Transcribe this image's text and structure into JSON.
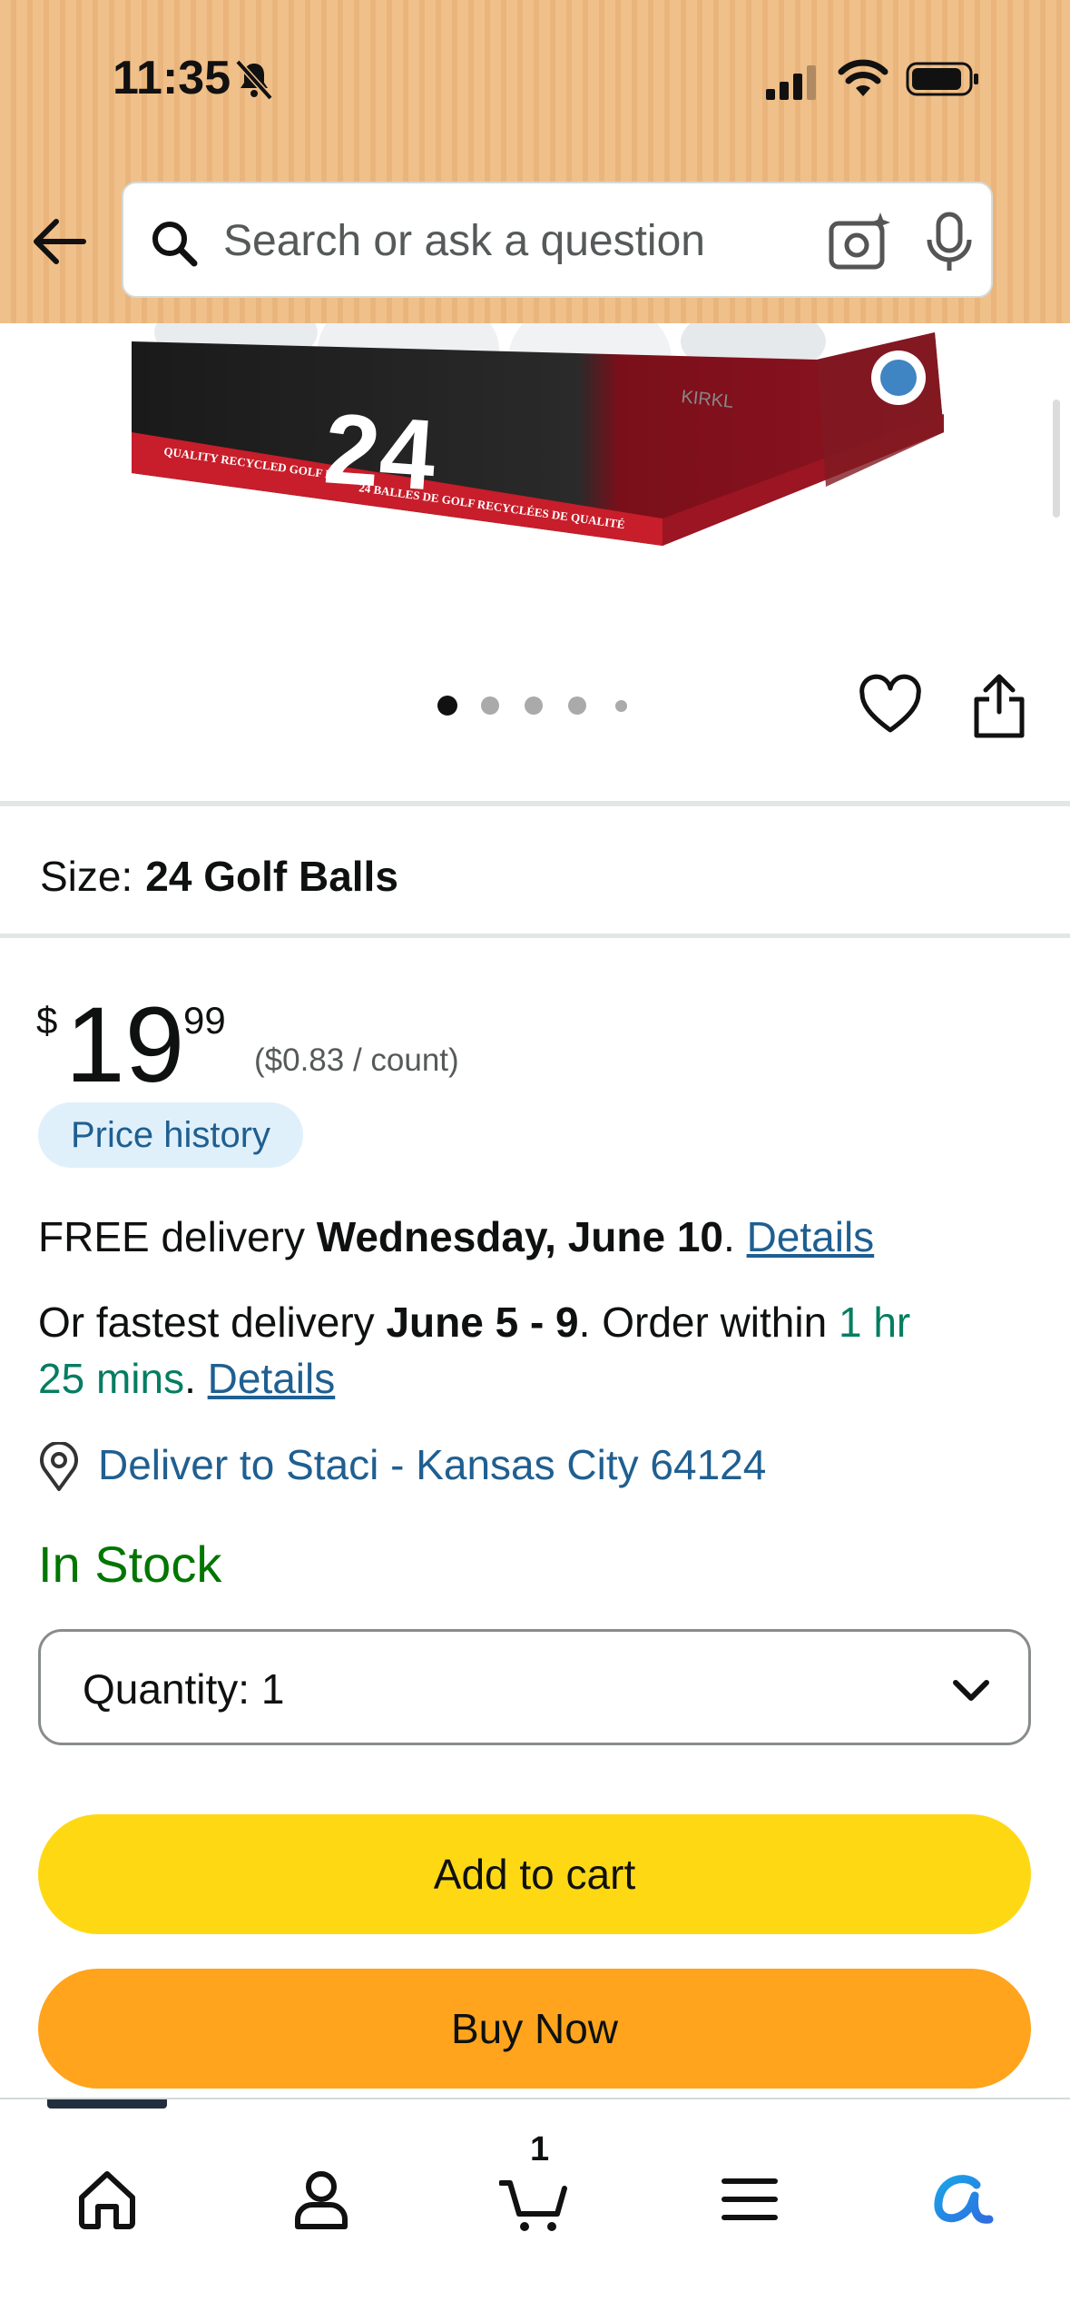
{
  "status_bar": {
    "time": "11:35"
  },
  "search": {
    "placeholder": "Search or ask a question"
  },
  "product": {
    "box_label_number": "24",
    "box_text_en": "QUALITY RECYCLED GOLF BALLS",
    "box_text_fr": "24 BALLES DE GOLF RECYCLÉES DE QUALITÉ",
    "box_brand": "KIRKL",
    "carousel_dots": 5,
    "carousel_active_index": 0
  },
  "size": {
    "label": "Size:",
    "value": "24 Golf Balls"
  },
  "price": {
    "currency": "$",
    "whole": "19",
    "fraction": "99",
    "per_unit": "($0.83 / count)",
    "history_label": "Price history"
  },
  "delivery": {
    "free_prefix": "FREE delivery ",
    "free_date": "Wednesday, June 10",
    "free_suffix": ". ",
    "details_link": "Details",
    "fast_prefix": "Or fastest delivery ",
    "fast_date": "June 5 - 9",
    "fast_mid": ". Order within ",
    "fast_time_part1": "1 hr",
    "fast_time_part2": "25 mins",
    "fast_suffix": ". ",
    "details_link_2": "Details",
    "deliver_to": "Deliver to Staci - Kansas City 64124"
  },
  "stock": {
    "status": "In Stock"
  },
  "quantity": {
    "label": "Quantity:",
    "value": "1"
  },
  "buttons": {
    "add_to_cart": "Add to cart",
    "buy_now": "Buy Now"
  },
  "bottom_nav": {
    "cart_count": "1"
  },
  "colors": {
    "header_bg": "#f0c08a",
    "add_to_cart": "#ffd814",
    "buy_now": "#ffa41c",
    "link": "#1f5f91",
    "in_stock": "#007600",
    "teal": "#067d62"
  }
}
